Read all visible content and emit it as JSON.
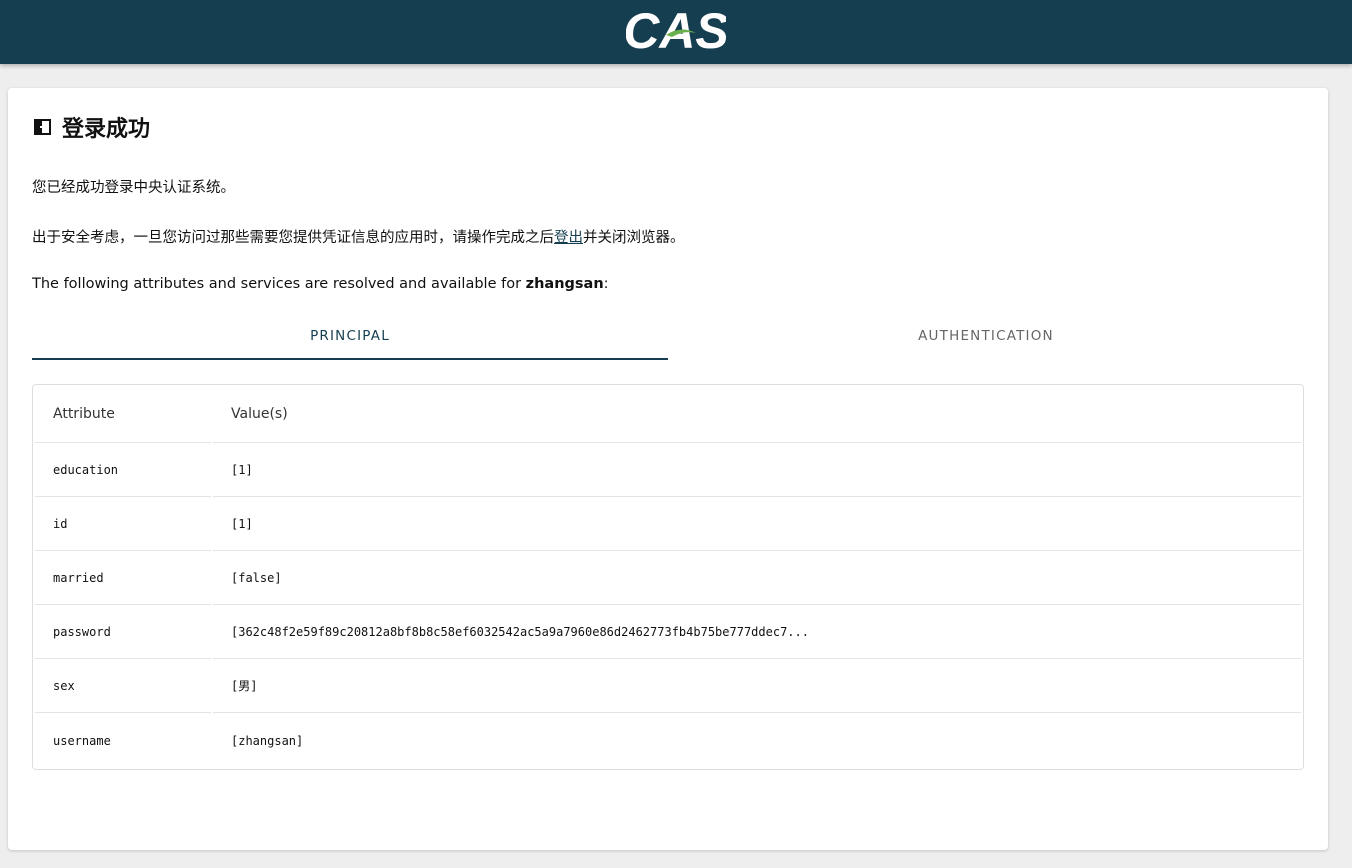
{
  "header": {
    "logo_text": "CAS",
    "bar_color": "#153e50"
  },
  "page": {
    "title": "登录成功",
    "title_icon": "door-open-icon",
    "line1": "您已经成功登录中央认证系统。",
    "line2_before": "出于安全考虑，一旦您访问过那些需要您提供凭证信息的应用时，请操作完成之后",
    "line2_link": "登出",
    "line2_after": "并关闭浏览器。",
    "line3_before": "The following attributes and services are resolved and available for ",
    "line3_user": "zhangsan",
    "line3_after": ":"
  },
  "tabs": [
    {
      "label": "PRINCIPAL",
      "active": true
    },
    {
      "label": "AUTHENTICATION",
      "active": false
    }
  ],
  "table": {
    "columns": [
      "Attribute",
      "Value(s)"
    ],
    "rows": [
      {
        "attribute": "education",
        "value": "[1]"
      },
      {
        "attribute": "id",
        "value": "[1]"
      },
      {
        "attribute": "married",
        "value": "[false]"
      },
      {
        "attribute": "password",
        "value": "[362c48f2e59f89c20812a8bf8b8c58ef6032542ac5a9a7960e86d2462773fb4b75be777ddec7..."
      },
      {
        "attribute": "sex",
        "value": "[男]"
      },
      {
        "attribute": "username",
        "value": "[zhangsan]"
      }
    ]
  },
  "colors": {
    "accent": "#153e50",
    "logo_leaf": "#6ab04c",
    "page_bg": "#eeeeee"
  }
}
